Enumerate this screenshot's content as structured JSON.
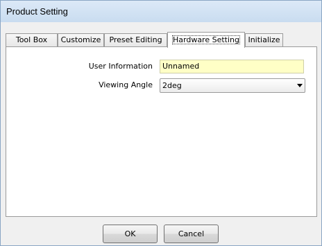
{
  "window": {
    "title": "Product Setting"
  },
  "tabs": [
    {
      "label": "Tool Box",
      "active": false
    },
    {
      "label": "Customize",
      "active": false
    },
    {
      "label": "Preset Editing",
      "active": false
    },
    {
      "label": "Hardware Setting",
      "active": true
    },
    {
      "label": "Initialize",
      "active": false
    }
  ],
  "hardware_setting": {
    "user_information": {
      "label": "User Information",
      "value": "Unnamed"
    },
    "viewing_angle": {
      "label": "Viewing Angle",
      "selected": "2deg"
    }
  },
  "buttons": {
    "ok": "OK",
    "cancel": "Cancel"
  },
  "colors": {
    "input_bg": "#ffffc6",
    "titlebar": "#c9dcf0"
  },
  "icons": {
    "dropdown": "chevron-down-icon"
  }
}
